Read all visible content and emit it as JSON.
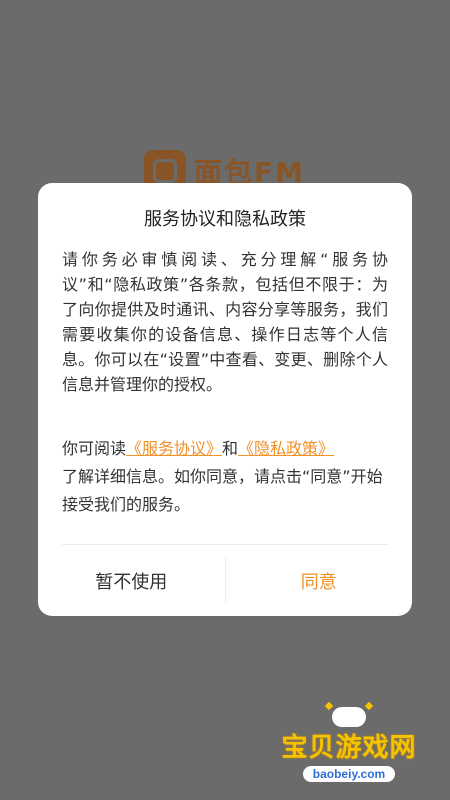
{
  "background": {
    "app_logo_text": "面包FM",
    "logo_color": "#8a5526",
    "overlay_color": "#6b6b6b"
  },
  "dialog": {
    "title": "服务协议和隐私政策",
    "body": "请你务必审慎阅读、充分理解“服务协议”和“隐私政策”各条款，包括但不限于：为了向你提供及时通讯、内容分享等服务，我们需要收集你的设备信息、操作日志等个人信息。你可以在“设置”中查看、变更、删除个人信息并管理你的授权。",
    "notice_prefix": "你可阅读",
    "link_service": "《服务协议》",
    "notice_and": "和",
    "link_privacy": "《隐私政策》",
    "notice_suffix": "了解详细信息。如你同意，请点击“同意”开始接受我们的服务。",
    "cancel_label": "暂不使用",
    "agree_label": "同意",
    "accent_color": "#f0912a"
  },
  "watermark": {
    "icon": "gamepad-icon",
    "text": "宝贝游戏网",
    "url": "baobeiy.com"
  }
}
